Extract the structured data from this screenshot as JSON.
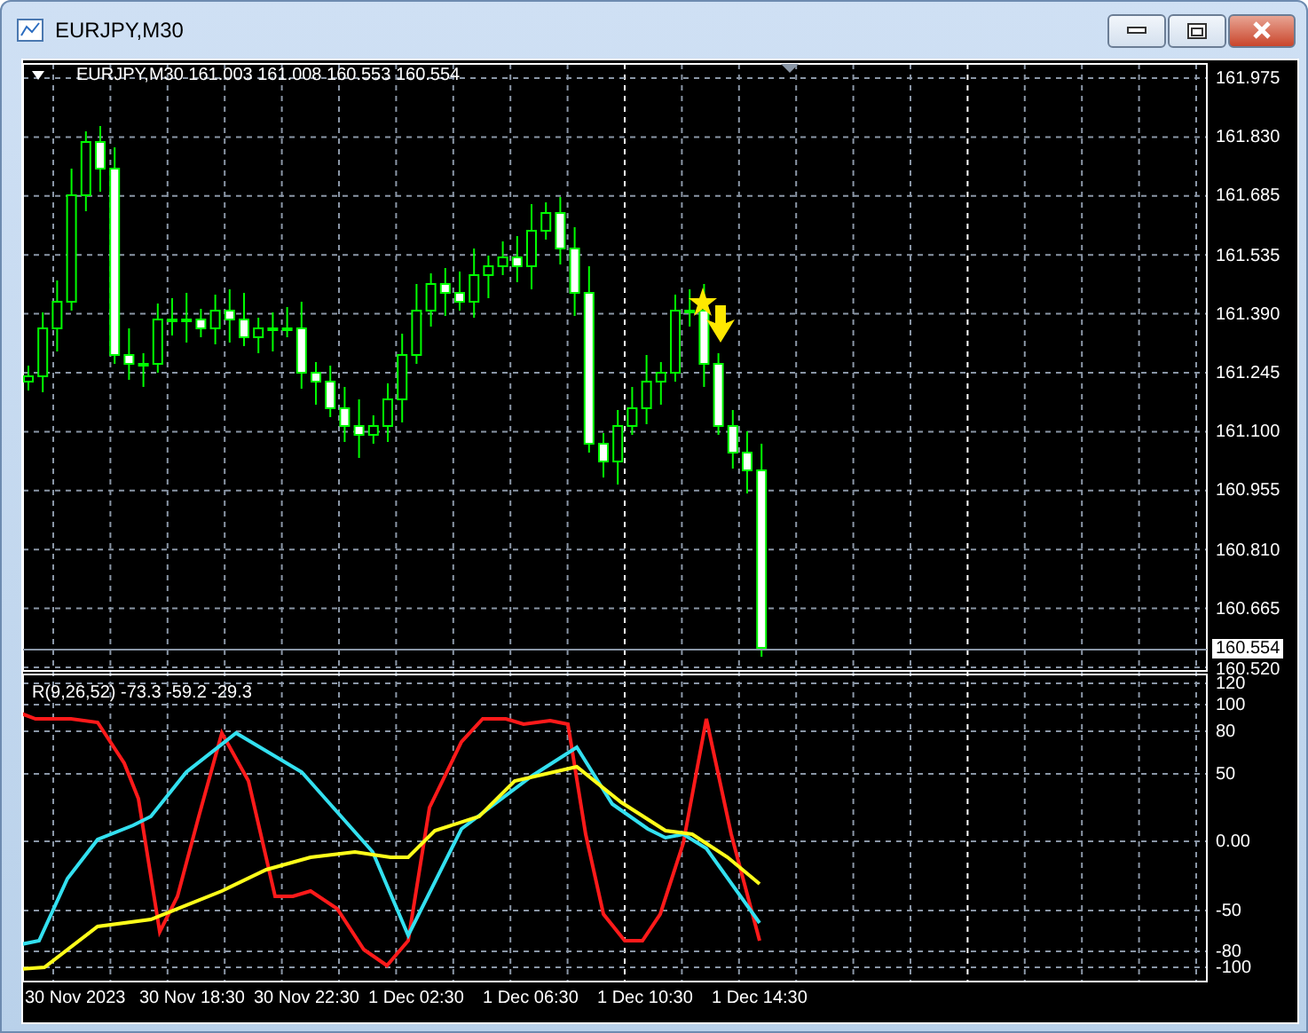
{
  "window": {
    "title": "EURJPY,M30"
  },
  "chart": {
    "header": "EURJPY,M30  161.003 161.008 160.553 160.554",
    "price_axis": [
      "161.975",
      "161.830",
      "161.685",
      "161.535",
      "161.390",
      "161.245",
      "161.100",
      "160.955",
      "160.810",
      "160.665",
      "160.520"
    ],
    "current_price": "160.554",
    "indicator": {
      "label": "R(9,26,52) -73.3 -59.2 -29.3",
      "axis": [
        "120",
        "100",
        "80",
        "50",
        "0.00",
        "-50",
        "-80",
        "-100"
      ]
    },
    "time_axis": [
      "30 Nov 2023",
      "30 Nov 18:30",
      "30 Nov 22:30",
      "1 Dec 02:30",
      "1 Dec 06:30",
      "1 Dec 10:30",
      "1 Dec 14:30"
    ]
  }
}
